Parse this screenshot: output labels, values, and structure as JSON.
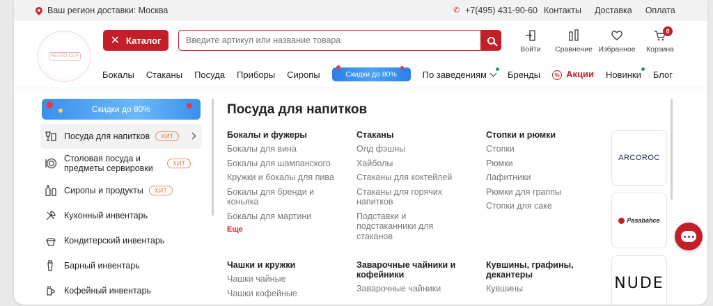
{
  "topbar": {
    "region": "Ваш регион доставки: Москва",
    "phone": "+7(495) 431-90-60",
    "links": [
      "Контакты",
      "Доставка",
      "Оплата"
    ]
  },
  "logo": {
    "text": "RESTO CUP"
  },
  "header": {
    "catalog_label": "Каталог",
    "search_placeholder": "Введите артикул или название товара",
    "actions": [
      {
        "label": "Войти",
        "icon": "login-icon"
      },
      {
        "label": "Сравнение",
        "icon": "compare-icon"
      },
      {
        "label": "Избранное",
        "icon": "heart-icon"
      },
      {
        "label": "Корзина",
        "icon": "cart-icon",
        "badge": "0"
      }
    ]
  },
  "nav": {
    "items": [
      "Бокалы",
      "Стаканы",
      "Посуда",
      "Приборы",
      "Сиропы"
    ],
    "promo": "Скидки до 80%",
    "venues": "По заведениям",
    "brands": "Бренды",
    "sale": "Акции",
    "news": "Новинки",
    "blog": "Блог"
  },
  "sidebar": {
    "banner": "Скидки до 80%",
    "hit_label": "ХИТ",
    "items": [
      {
        "label": "Посуда для напитков",
        "icon": "glasses-icon",
        "hit": true
      },
      {
        "label": "Столовая посуда и предметы сервировки",
        "icon": "plate-icon",
        "hit": true
      },
      {
        "label": "Сиропы и продукты",
        "icon": "bottles-icon",
        "hit": true
      },
      {
        "label": "Кухонный инвентарь",
        "icon": "kitchen-tools-icon",
        "hit": false
      },
      {
        "label": "Кондитерский инвентарь",
        "icon": "cupcake-icon",
        "hit": false
      },
      {
        "label": "Барный инвентарь",
        "icon": "shaker-icon",
        "hit": false
      },
      {
        "label": "Кофейный инвентарь",
        "icon": "coffee-tools-icon",
        "hit": false
      }
    ]
  },
  "mega": {
    "title": "Посуда для напитков",
    "more": "Еще",
    "columns": [
      {
        "heading": "Бокалы и фужеры",
        "links": [
          "Бокалы для вина",
          "Бокалы для шампанского",
          "Кружки и бокалы для пива",
          "Бокалы для бренди и коньяка",
          "Бокалы для мартини"
        ]
      },
      {
        "heading": "Стаканы",
        "links": [
          "Олд фэшны",
          "Хайболы",
          "Стаканы для коктейлей",
          "Стаканы для горячих напитков",
          "Подставки и подстаканники для стаканов"
        ]
      },
      {
        "heading": "Стопки и рюмки",
        "links": [
          "Стопки",
          "Рюмки",
          "Лафитники",
          "Рюмки для граппы",
          "Стопки для саке"
        ]
      },
      {
        "heading": "Чашки и кружки",
        "links": [
          "Чашки чайные",
          "Чашки кофейные"
        ]
      },
      {
        "heading": "Заварочные чайники и кофейники",
        "links": [
          "Заварочные чайники"
        ]
      },
      {
        "heading": "Кувшины, графины, декантеры",
        "links": [
          "Кувшины"
        ]
      }
    ]
  },
  "brands": [
    "ARCOROC",
    "Pasabahce",
    "NUDE"
  ],
  "colors": {
    "accent": "#c41f28",
    "promo": "#2d7ee6",
    "hit": "#e07a46"
  }
}
